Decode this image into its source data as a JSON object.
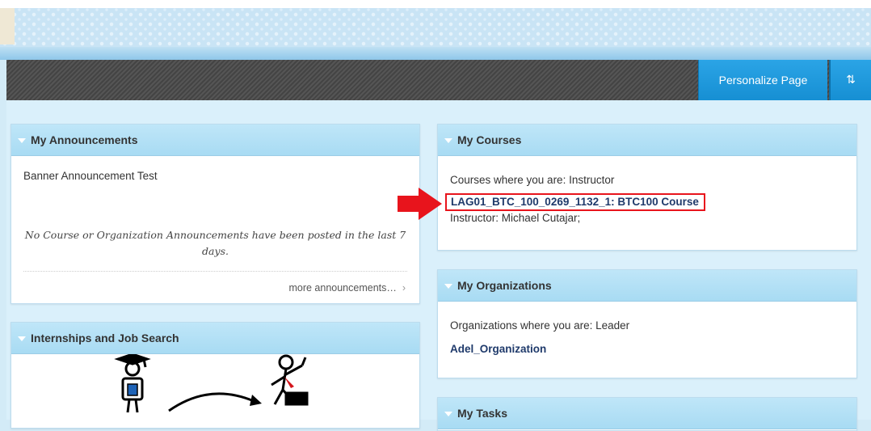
{
  "toolbar": {
    "personalize_label": "Personalize Page",
    "reorder_icon": "⇅"
  },
  "announcements": {
    "title": "My Announcements",
    "banner_item": "Banner Announcement Test",
    "empty_message": "No Course or Organization Announcements have been posted in the last 7 days.",
    "more_link": "more announcements…",
    "more_chevron": "›"
  },
  "internships": {
    "title": "Internships and Job Search"
  },
  "courses": {
    "title": "My Courses",
    "role_text": "Courses where you are: Instructor",
    "course_link": "LAG01_BTC_100_0269_1132_1: BTC100 Course",
    "instructor_text": "Instructor: Michael Cutajar;",
    "highlight_color": "#e8141c"
  },
  "organizations": {
    "title": "My Organizations",
    "role_text": "Organizations where you are: Leader",
    "org_link": "Adel_Organization"
  },
  "tasks": {
    "title": "My Tasks"
  }
}
